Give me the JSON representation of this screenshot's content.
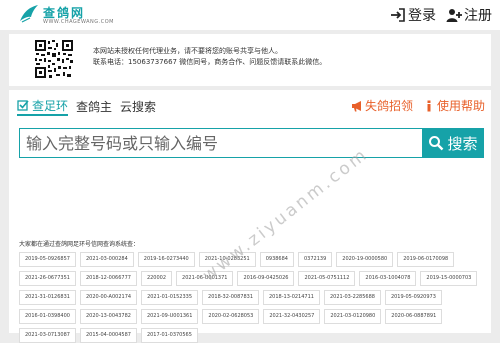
{
  "header": {
    "logo_title": "查鸽网",
    "logo_sub": "WWW.CHAGEWANG.COM",
    "login_label": "登录",
    "register_label": "注册"
  },
  "notice": {
    "line1": "本网站未授权任何代理业务，请不要将您的账号共享与他人。",
    "line2": "联系电话：15063737667 微信同号，商务合作、问题反馈请联系此微信。"
  },
  "tabs": [
    {
      "label": "查足环",
      "active": true
    },
    {
      "label": "查鸽主",
      "active": false
    },
    {
      "label": "云搜索",
      "active": false
    }
  ],
  "links": {
    "lost_label": "失鸽招领",
    "help_label": "使用帮助"
  },
  "search": {
    "placeholder": "输入完整号码或只输入编号",
    "button_label": "搜索"
  },
  "recent": {
    "label": "大家都在通过查鸽网足环号信网查询系统查：",
    "items": [
      "2019-05-0926857",
      "2021-03-000284",
      "2019-16-0273440",
      "2021-10-0283251",
      "0938684",
      "0372139",
      "2020-19-0000580",
      "2019-06-0170098",
      "2021-26-0677351",
      "2018-12-0066777",
      "220002",
      "2021-06-U001371",
      "2016-09-0425026",
      "2021-05-0751112",
      "2016-03-1004078",
      "2019-15-0000703",
      "2021-31-0126831",
      "2020-00-A002174",
      "2021-01-0152335",
      "2018-32-0087831",
      "2018-13-0214711",
      "2021-03-2285688",
      "2019-05-0920973",
      "2016-01-0398400",
      "2020-13-0043782",
      "2021-09-U001361",
      "2020-02-0628053",
      "2021-32-0430257",
      "2021-03-0120980",
      "2020-06-0887891",
      "2021-03-0713087",
      "2015-04-0004587",
      "2017-01-0370565"
    ]
  },
  "watermark": "www.ziyuanm.com",
  "colors": {
    "accent": "#16a2a8",
    "orange": "#e8602a"
  }
}
